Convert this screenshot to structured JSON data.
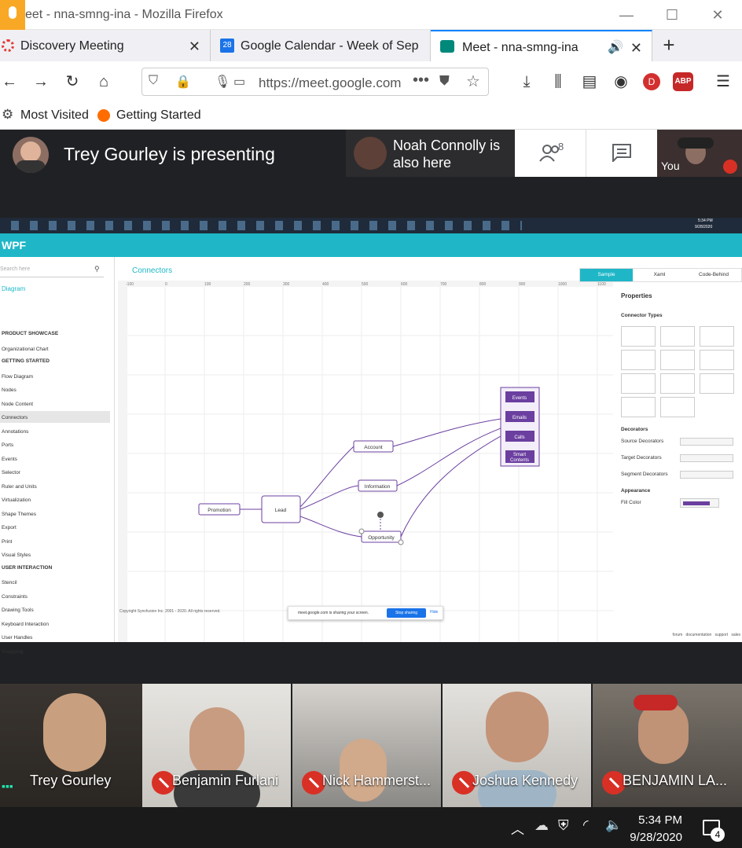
{
  "firefox": {
    "window_title": "eet - nna-smng-ina - Mozilla Firefox",
    "tabs": [
      {
        "label": "Discovery Meeting"
      },
      {
        "label": "Google Calendar - Week of Sep"
      },
      {
        "label": "Meet - nna-smng-ina"
      }
    ],
    "calendar_badge": "28",
    "new_tab_glyph": "+",
    "url": "https://meet.google.com",
    "profile_letter": "D",
    "abp_label": "ABP",
    "bookmarks": [
      {
        "label": "Most Visited"
      },
      {
        "label": "Getting Started"
      }
    ]
  },
  "meet": {
    "presenter_text": "Trey Gourley is presenting",
    "also_here_text": "Noah Connolly is also here",
    "people_count": "8",
    "you_label": "You",
    "participants": [
      {
        "name": "Trey Gourley"
      },
      {
        "name": "Benjamin Furlani"
      },
      {
        "name": "Nick Hammerst..."
      },
      {
        "name": "Joshua Kennedy"
      },
      {
        "name": "BENJAMIN LA..."
      }
    ]
  },
  "shared_screen": {
    "app_logo": "WPF",
    "search_placeholder": "Search here",
    "diagram_link": "Diagram",
    "page_title": "Connectors",
    "sample_tabs": [
      "Sample",
      "Xaml",
      "Code-Behind"
    ],
    "ruler_x": [
      "-100",
      "0",
      "100",
      "200",
      "300",
      "400",
      "500",
      "600",
      "700",
      "800",
      "900",
      "1000",
      "1100"
    ],
    "sidebar": [
      {
        "type": "head",
        "label": "PRODUCT SHOWCASE"
      },
      {
        "type": "item",
        "label": "Organizational Chart"
      },
      {
        "type": "head",
        "label": "GETTING STARTED"
      },
      {
        "type": "item",
        "label": "Flow Diagram"
      },
      {
        "type": "item",
        "label": "Nodes"
      },
      {
        "type": "item",
        "label": "Node Content"
      },
      {
        "type": "item",
        "label": "Connectors",
        "selected": true
      },
      {
        "type": "item",
        "label": "Annotations"
      },
      {
        "type": "item",
        "label": "Ports"
      },
      {
        "type": "item",
        "label": "Events"
      },
      {
        "type": "item",
        "label": "Selector"
      },
      {
        "type": "item",
        "label": "Ruler and Units"
      },
      {
        "type": "item",
        "label": "Virtualization"
      },
      {
        "type": "item",
        "label": "Shape Themes"
      },
      {
        "type": "item",
        "label": "Export"
      },
      {
        "type": "item",
        "label": "Print"
      },
      {
        "type": "item",
        "label": "Visual Styles"
      },
      {
        "type": "head",
        "label": "USER INTERACTION"
      },
      {
        "type": "item",
        "label": "Stencil"
      },
      {
        "type": "item",
        "label": "Constraints"
      },
      {
        "type": "item",
        "label": "Drawing Tools"
      },
      {
        "type": "item",
        "label": "Keyboard Interaction"
      },
      {
        "type": "item",
        "label": "User Handles"
      },
      {
        "type": "item",
        "label": "Snapping"
      }
    ],
    "diagram_nodes": {
      "promotion": "Promotion",
      "lead": "Lead",
      "account": "Account",
      "information": "Information",
      "opportunity": "Opportunity",
      "events": "Events",
      "emails": "Emails",
      "calls": "Calls",
      "smart_contents_1": "Smart",
      "smart_contents_2": "Contents"
    },
    "properties": {
      "title": "Properties",
      "connector_types": "Connector Types",
      "decorators": "Decorators",
      "source_decorators": "Source Decorators",
      "target_decorators": "Target Decorators",
      "segment_decorators": "Segment Decorators",
      "appearance": "Appearance",
      "fill_color": "Fill Color",
      "fill_color_value": "#6b3fa0"
    },
    "footer": {
      "copyright": "Copyright Syncfusion Inc. 2001 - 2020. All rights reserved.",
      "links": [
        "forum",
        "documentation",
        "support",
        "sales"
      ]
    },
    "share_bar": {
      "text": "meet.google.com is sharing your screen.",
      "stop": "Stop sharing",
      "hide": "Hide"
    },
    "win_clock": {
      "time": "5:34 PM",
      "date": "9/28/2020"
    }
  },
  "taskbar": {
    "time": "5:34 PM",
    "date": "9/28/2020",
    "notifications": "4"
  },
  "colors": {
    "meet_bg": "#202124",
    "accent_teal": "#1fb7c8",
    "node_purple": "#6b3fa0",
    "mute_red": "#d93025",
    "firefox_blue": "#0a84ff"
  }
}
